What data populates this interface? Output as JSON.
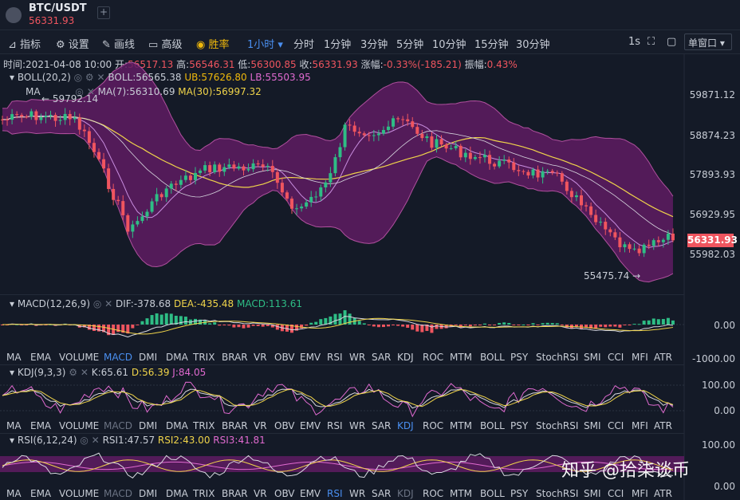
{
  "header": {
    "pair": "BTC/USDT",
    "last_price": "56331.93",
    "add_tab": "+"
  },
  "toolbar": {
    "indicators": "指标",
    "settings": "设置",
    "drawing": "画线",
    "advanced": "高级",
    "win_rate": "胜率",
    "interval_selected": "1小时",
    "intervals": [
      "分时",
      "1分钟",
      "3分钟",
      "5分钟",
      "10分钟",
      "15分钟",
      "30分钟"
    ],
    "refresh_rate": "1s",
    "window_mode": "单窗口"
  },
  "ohlc": {
    "time": "时间:2021-04-08 10:00",
    "open_label": "开:",
    "open": "56517.13",
    "high_label": "高:",
    "high": "56546.31",
    "low_label": "低:",
    "low": "56300.85",
    "close_label": "收:",
    "close": "56331.93",
    "change_label": "涨幅:",
    "change": "-0.33%(-185.21)",
    "amp_label": "振幅:",
    "amp": "0.43%"
  },
  "main_legend": {
    "boll_name": "BOLL(20,2)",
    "boll": "BOLL:56565.38",
    "ub": "UB:57626.80",
    "lb": "LB:55503.95",
    "ma_name": "MA",
    "ma7": "MA(7):56310.69",
    "ma30": "MA(30):56997.32"
  },
  "main_axis": [
    "59871.12",
    "58874.23",
    "57893.93",
    "56929.95",
    "55982.03"
  ],
  "annotations": {
    "high": "← 59792.14",
    "low": "55475.74 →"
  },
  "macd_legend": {
    "name": "MACD(12,26,9)",
    "dif": "DIF:-378.68",
    "dea": "DEA:-435.48",
    "macd": "MACD:113.61"
  },
  "macd_axis": [
    "0.00",
    "-1000.00"
  ],
  "kdj_legend": {
    "name": "KDJ(9,3,3)",
    "k": "K:65.61",
    "d": "D:56.39",
    "j": "J:84.05"
  },
  "kdj_axis": [
    "100.00",
    "0.00"
  ],
  "rsi_legend": {
    "name": "RSI(6,12,24)",
    "r1": "RSI1:47.57",
    "r2": "RSI2:43.00",
    "r3": "RSI3:41.81"
  },
  "rsi_axis": [
    "100.00",
    "0.00"
  ],
  "indicator_tabs": [
    "MA",
    "EMA",
    "VOLUME",
    "MACD",
    "DMI",
    "DMA",
    "TRIX",
    "BRAR",
    "VR",
    "OBV",
    "EMV",
    "RSI",
    "WR",
    "SAR",
    "KDJ",
    "ROC",
    "MTM",
    "BOLL",
    "PSY",
    "StochRSI",
    "SMI",
    "CCI",
    "MFI",
    "ATR"
  ],
  "watermark": "知乎 @拾柒谈币",
  "colors": {
    "up": "#2ebd85",
    "down": "#f0555f",
    "accent": "#4a8ff0",
    "band": "#6a1f6b",
    "ma30": "#f0d44a",
    "ma7": "#c98ee0"
  }
}
